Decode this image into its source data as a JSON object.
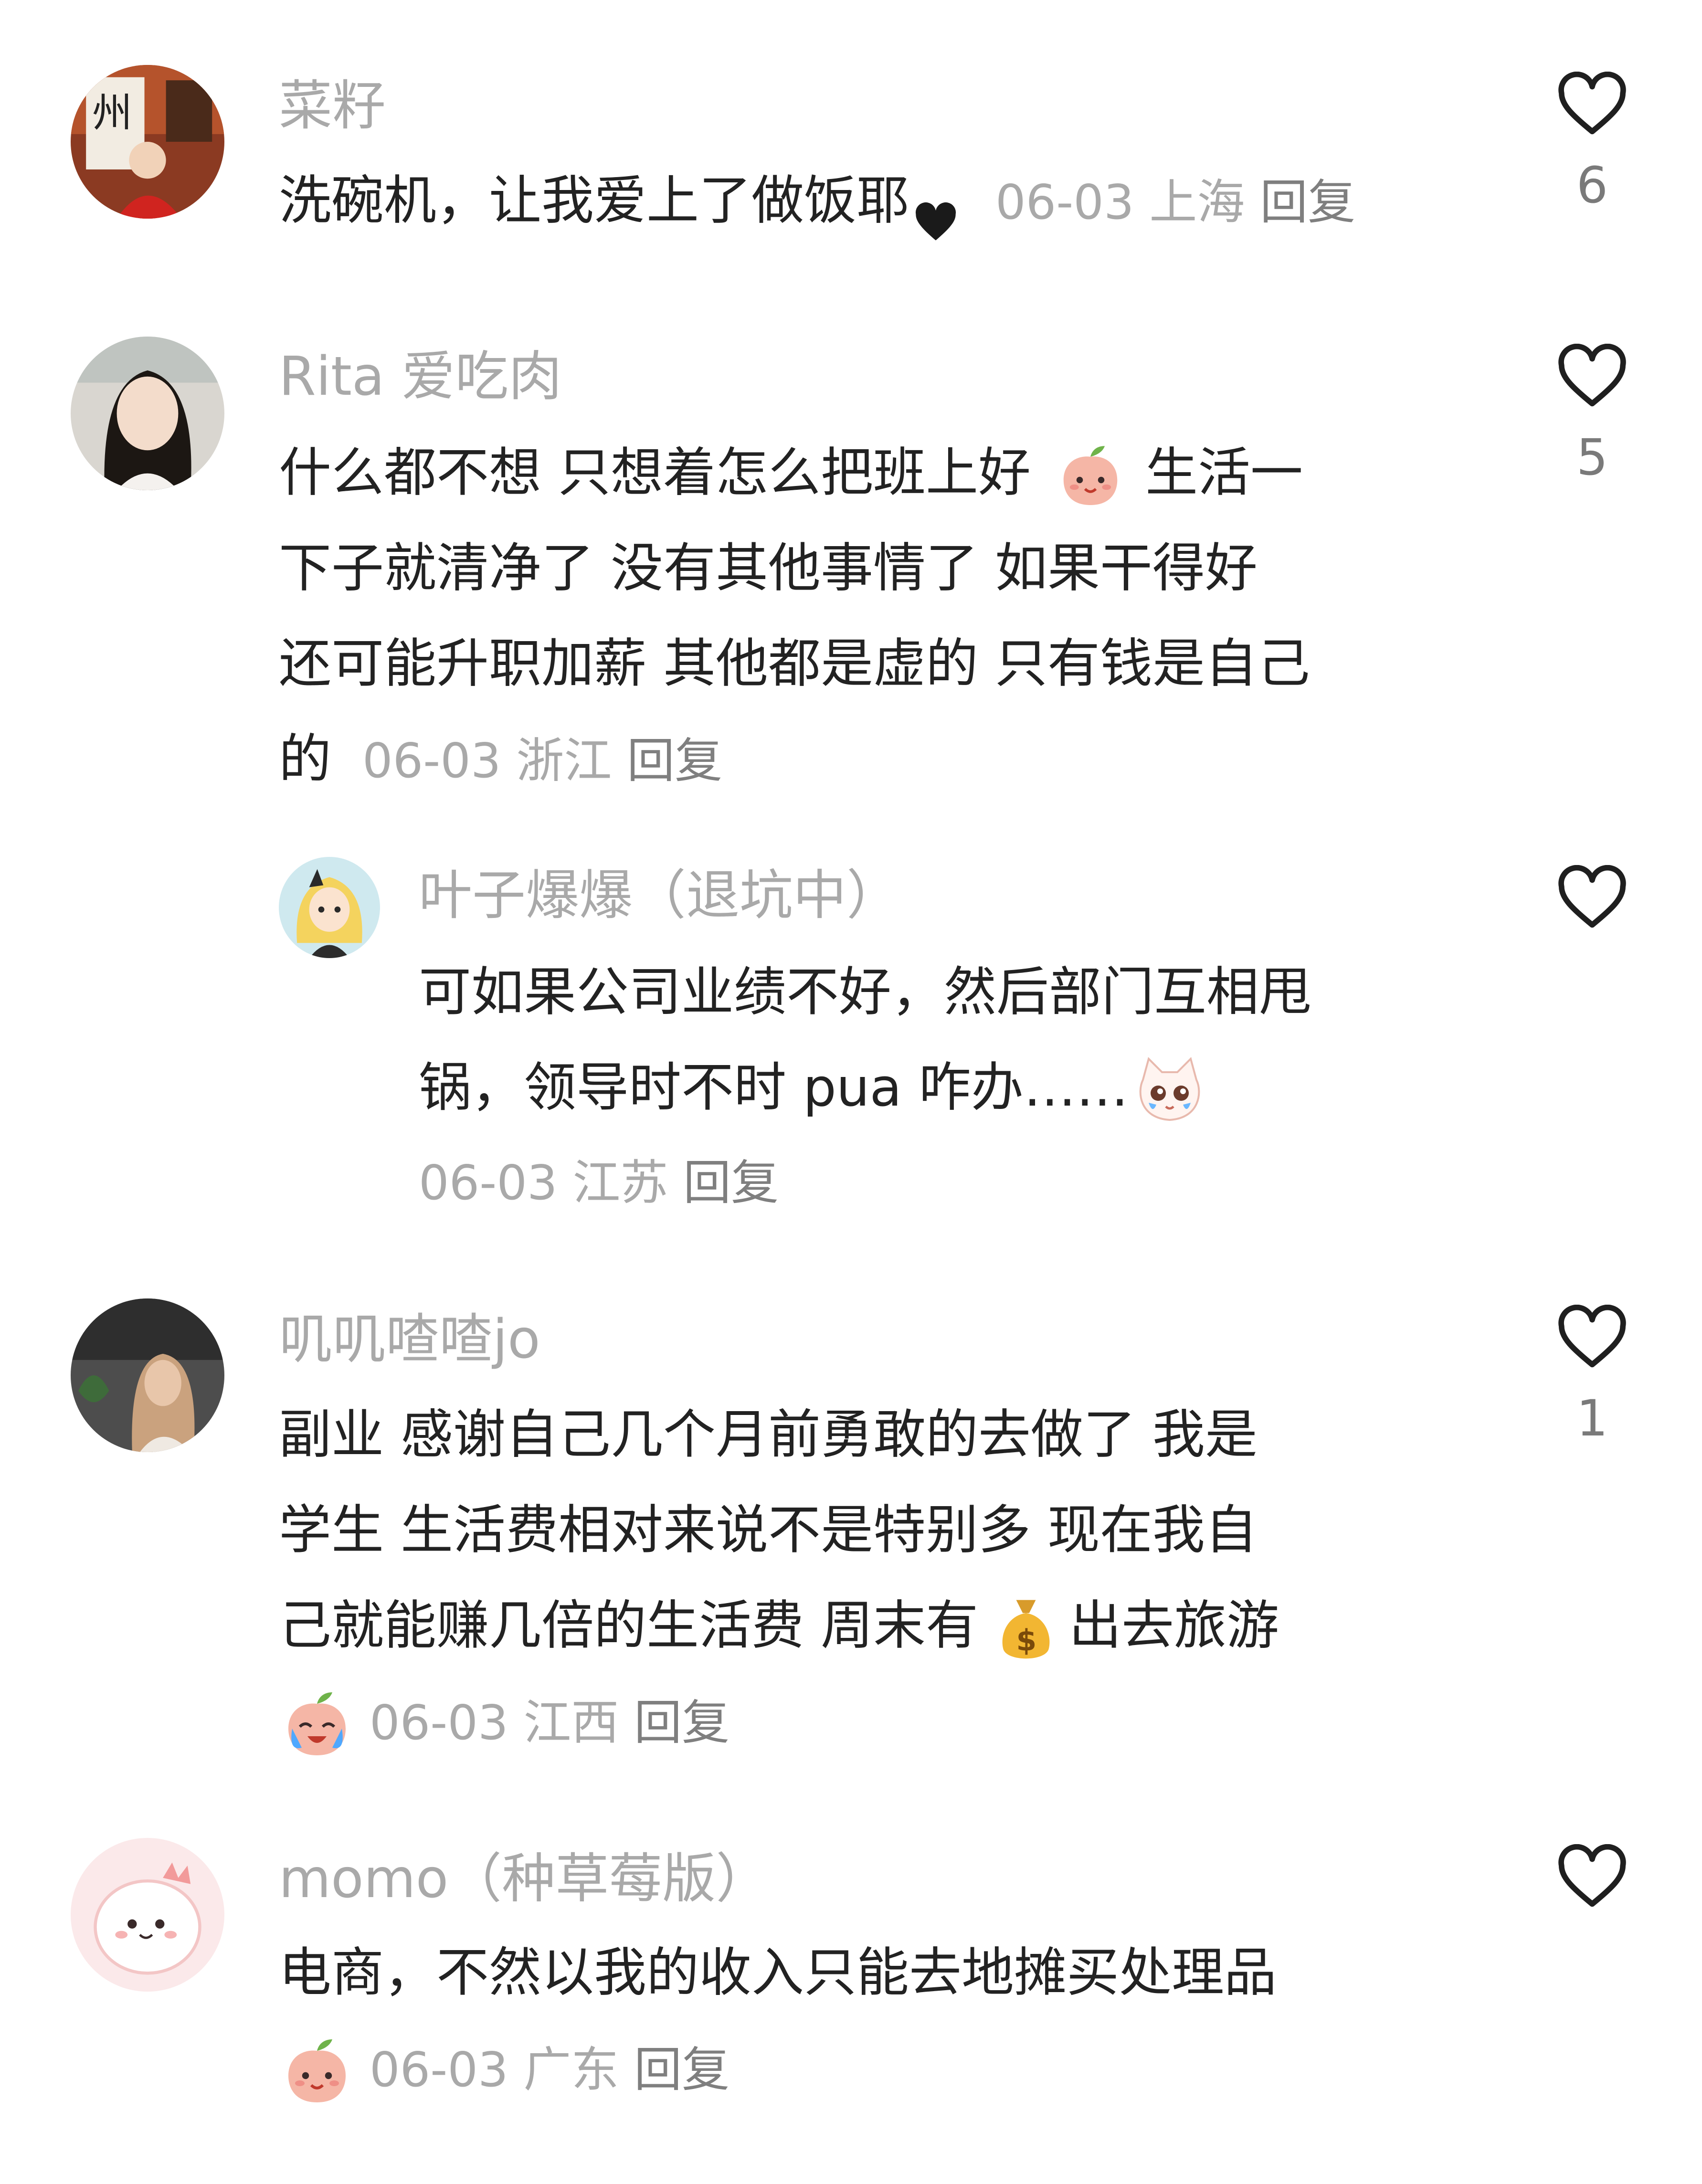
{
  "comments": [
    {
      "user": "菜籽",
      "lines": [
        "洗碗机，让我爱上了做饭耶"
      ],
      "inline_emoji": "black-heart",
      "date": "06-03",
      "location": "上海",
      "reply": "回复",
      "likes": "6"
    },
    {
      "user": "Rita 爱吃肉",
      "lines": [
        "什么都不想 只想着怎么把班上好",
        "生活一",
        "下子就清净了 没有其他事情了 如果干得好",
        "还可能升职加薪 其他都是虚的 只有钱是自己",
        "的"
      ],
      "inline_emoji": "peach-face",
      "date": "06-03",
      "location": "浙江",
      "reply": "回复",
      "likes": "5"
    },
    {
      "user": "叶子爆爆（退坑中）",
      "lines": [
        "可如果公司业绩不好，然后部门互相甩",
        "锅，领导时不时 pua 咋办……"
      ],
      "inline_emoji": "teary-cat",
      "date": "06-03",
      "location": "江苏",
      "reply": "回复",
      "likes": ""
    },
    {
      "user": "叽叽喳喳jo",
      "lines": [
        "副业 感谢自己几个月前勇敢的去做了  我是",
        "学生  生活费相对来说不是特别多  现在我自",
        "己就能赚几倍的生活费  周末有",
        "出去旅游"
      ],
      "inline_emoji": "money-bag",
      "trailing_emoji": "crying-peach",
      "date": "06-03",
      "location": "江西",
      "reply": "回复",
      "likes": "1"
    },
    {
      "user": "momo（种草莓版）",
      "lines": [
        "电商，不然以我的收入只能去地摊买处理品"
      ],
      "trailing_emoji": "peach-face",
      "date": "06-03",
      "location": "广东",
      "reply": "回复",
      "likes": ""
    }
  ],
  "icons": {
    "like": "heart-outline-icon"
  }
}
